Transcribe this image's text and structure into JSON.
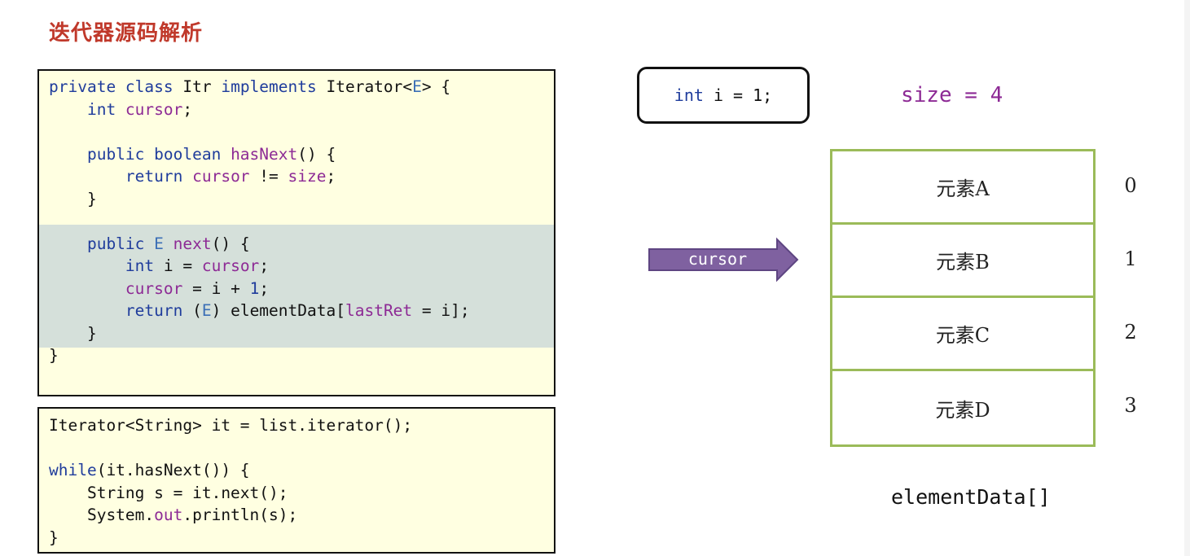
{
  "title": "迭代器源码解析",
  "class_code": {
    "lines": [
      [
        {
          "t": "private class ",
          "c": "k"
        },
        {
          "t": "Itr ",
          "c": ""
        },
        {
          "t": "implements ",
          "c": "k"
        },
        {
          "t": "Iterator<",
          "c": ""
        },
        {
          "t": "E",
          "c": "t"
        },
        {
          "t": "> {",
          "c": ""
        }
      ],
      [
        {
          "t": "    int ",
          "c": "k"
        },
        {
          "t": "cursor",
          "c": "f"
        },
        {
          "t": ";",
          "c": ""
        }
      ],
      [],
      [
        {
          "t": "    public boolean ",
          "c": "k"
        },
        {
          "t": "hasNext",
          "c": "f"
        },
        {
          "t": "() {",
          "c": ""
        }
      ],
      [
        {
          "t": "        return ",
          "c": "k"
        },
        {
          "t": "cursor ",
          "c": "f"
        },
        {
          "t": "!= ",
          "c": ""
        },
        {
          "t": "size",
          "c": "f"
        },
        {
          "t": ";",
          "c": ""
        }
      ],
      [
        {
          "t": "    }",
          "c": ""
        }
      ],
      [],
      [
        {
          "t": "    public ",
          "c": "k"
        },
        {
          "t": "E ",
          "c": "t"
        },
        {
          "t": "next",
          "c": "f"
        },
        {
          "t": "() {",
          "c": ""
        }
      ],
      [
        {
          "t": "        int ",
          "c": "k"
        },
        {
          "t": "i = ",
          "c": ""
        },
        {
          "t": "cursor",
          "c": "f"
        },
        {
          "t": ";",
          "c": ""
        }
      ],
      [
        {
          "t": "        cursor ",
          "c": "f"
        },
        {
          "t": "= i + ",
          "c": ""
        },
        {
          "t": "1",
          "c": "n"
        },
        {
          "t": ";",
          "c": ""
        }
      ],
      [
        {
          "t": "        return ",
          "c": "k"
        },
        {
          "t": "(",
          "c": ""
        },
        {
          "t": "E",
          "c": "t"
        },
        {
          "t": ") elementData[",
          "c": ""
        },
        {
          "t": "lastRet ",
          "c": "f"
        },
        {
          "t": "= i];",
          "c": ""
        }
      ],
      [
        {
          "t": "    }",
          "c": ""
        }
      ],
      [
        {
          "t": "}",
          "c": ""
        }
      ]
    ]
  },
  "usage_code": {
    "lines": [
      [
        {
          "t": "Iterator<String> it = list.iterator();",
          "c": ""
        }
      ],
      [],
      [
        {
          "t": "while",
          "c": "k"
        },
        {
          "t": "(it.hasNext()) {",
          "c": ""
        }
      ],
      [
        {
          "t": "    String s = it.next();",
          "c": ""
        }
      ],
      [
        {
          "t": "    System.",
          "c": ""
        },
        {
          "t": "out",
          "c": "f"
        },
        {
          "t": ".println(s);",
          "c": ""
        }
      ],
      [
        {
          "t": "}",
          "c": ""
        }
      ]
    ]
  },
  "var_i": "int i = 1;",
  "size_label": "size = 4",
  "arrow_label": "cursor",
  "array": {
    "cells": [
      "元素A",
      "元素B",
      "元素C",
      "元素D"
    ],
    "indices": [
      "0",
      "1",
      "2",
      "3"
    ],
    "name": "elementData[]"
  },
  "colors": {
    "title": "#c0392b",
    "keyword": "#1f3c9c",
    "field": "#8d2a95",
    "code_bg": "#ffffe1",
    "highlight": "#d5e0da",
    "arrow": "#7f61a0",
    "array_border": "#9bbb59"
  }
}
